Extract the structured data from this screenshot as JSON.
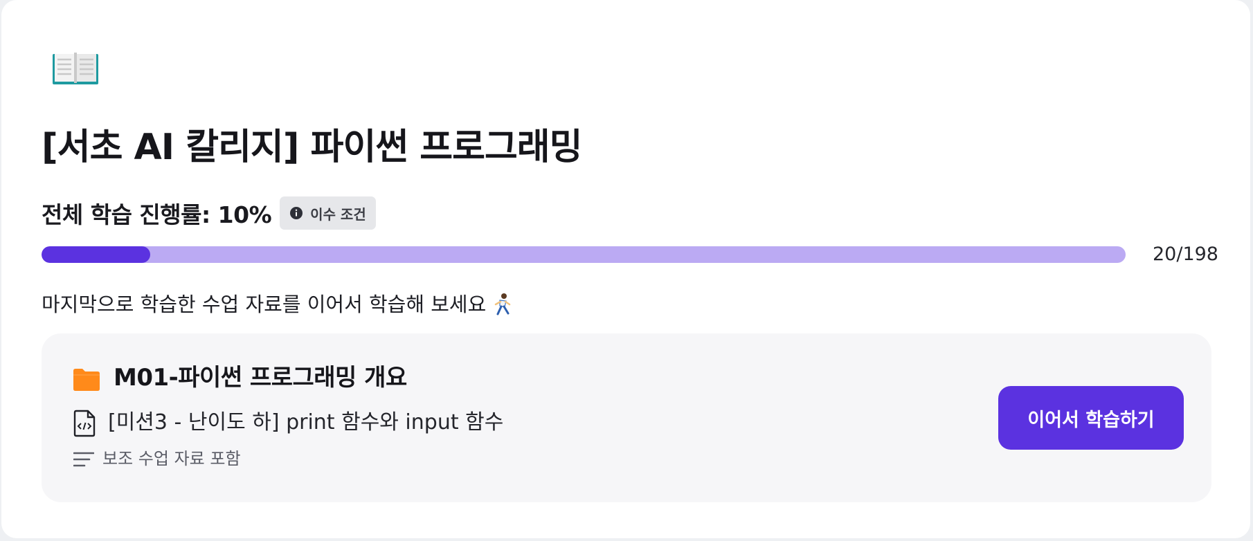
{
  "course": {
    "icon": "open-book-icon",
    "title": "[서초 AI 칼리지] 파이썬 프로그래밍"
  },
  "progress": {
    "label": "전체 학습 진행률: 10%",
    "percent": 10,
    "requirement_badge": "이수 조건",
    "requirement_icon": "info-icon",
    "completed_count": "20/198"
  },
  "resume": {
    "prompt": "마지막으로 학습한 수업 자료를 이어서 학습해 보세요",
    "emoji": "running-person-icon"
  },
  "lesson": {
    "module_icon": "folder-icon",
    "module_title": "M01-파이썬 프로그래밍 개요",
    "file_icon": "code-file-icon",
    "lesson_title": "[미션3 - 난이도 하] print 함수와 input 함수",
    "supplement_icon": "lines-icon",
    "supplement_text": "보조 수업 자료 포함",
    "continue_label": "이어서 학습하기"
  },
  "colors": {
    "accent": "#5b32e0",
    "progress_track": "#bbaaf3",
    "folder": "#ff8a1a",
    "book": "#1e9aa0"
  }
}
